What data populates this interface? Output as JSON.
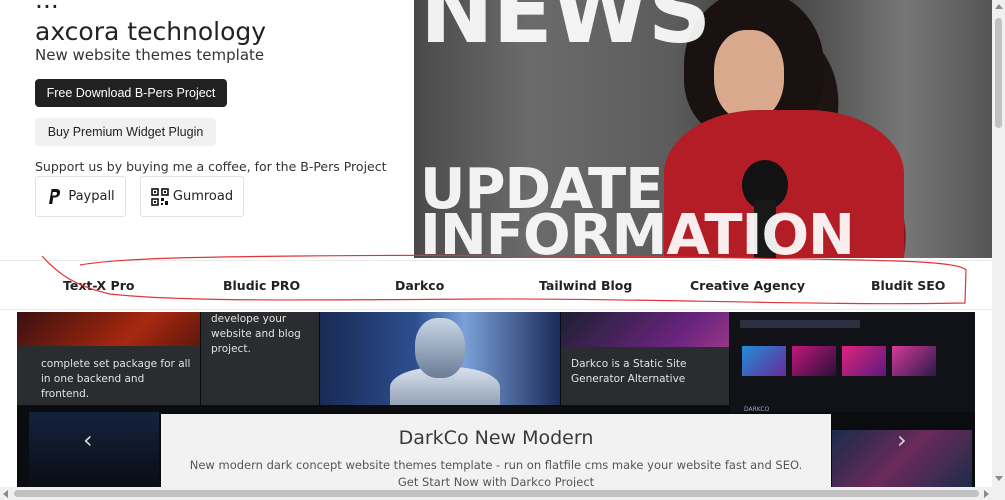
{
  "hero": {
    "title_lines": [
      "...",
      "axcora technology"
    ],
    "subtitle": "New website themes template",
    "primary_button": "Free Download B-Pers Project",
    "secondary_button": "Buy Premium Widget Plugin",
    "support_text": "Support us by buying me a coffee, for the B-Pers Project",
    "pay_buttons": [
      {
        "label": "Paypall",
        "icon": "paypal-icon"
      },
      {
        "label": "Gumroad",
        "icon": "qr-code-icon"
      }
    ],
    "image_words": [
      "NEWS",
      "UPDATE",
      "INFORMATION"
    ]
  },
  "nav": {
    "items": [
      "Text-X Pro",
      "Bludic PRO",
      "Darkco",
      "Tailwind Blog",
      "Creative Agency",
      "Bludit SEO"
    ]
  },
  "annotation": {
    "color": "#e0343a"
  },
  "showcase": {
    "captions": [
      "complete set package for all in one backend and frontend.",
      "develope your website and blog project.",
      "Darkco is a Static Site Generator Alternative"
    ],
    "mini_labels": [
      "DARKCO"
    ],
    "card": {
      "title": "DarkCo New Modern",
      "description": "New modern dark concept website themes template - run on flatfile cms make your website fast and SEO.",
      "cta": "Get Start Now with Darkco Project"
    },
    "arrow_left": "‹",
    "arrow_right": "›"
  }
}
